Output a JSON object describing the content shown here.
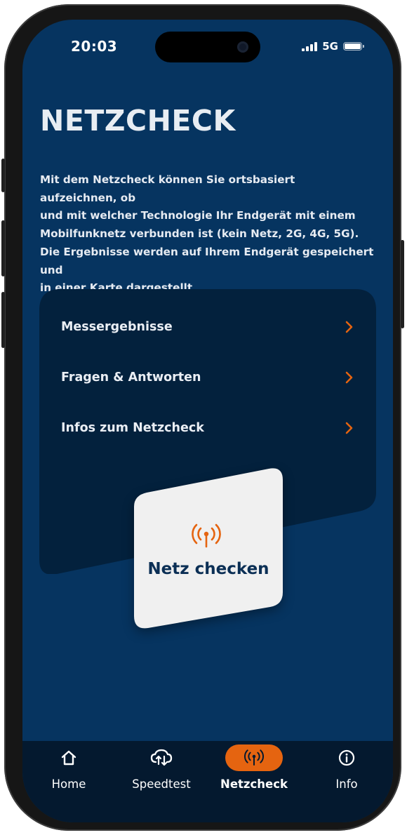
{
  "status_bar": {
    "time": "20:03",
    "network": "5G"
  },
  "page": {
    "title": "NETZCHECK",
    "intro": "Mit dem Netzcheck können Sie ortsbasiert aufzeichnen, ob\nund mit welcher Technologie Ihr Endgerät mit einem\nMobilfunknetz verbunden ist (kein Netz, 2G, 4G, 5G).\nDie Ergebnisse werden auf Ihrem Endgerät gespeichert und\nin einer Karte dargestellt."
  },
  "menu": {
    "items": [
      {
        "label": "Messergebnisse",
        "icon": "chevron-right-icon"
      },
      {
        "label": "Fragen & Antworten",
        "icon": "chevron-right-icon"
      },
      {
        "label": "Infos zum Netzcheck",
        "icon": "chevron-right-icon"
      }
    ]
  },
  "check_button": {
    "label": "Netz checken",
    "icon": "antenna-icon"
  },
  "tabbar": {
    "tabs": [
      {
        "label": "Home",
        "icon": "home-icon",
        "active": false
      },
      {
        "label": "Speedtest",
        "icon": "cloud-speedtest-icon",
        "active": false
      },
      {
        "label": "Netzcheck",
        "icon": "antenna-icon",
        "active": true
      },
      {
        "label": "Info",
        "icon": "info-icon",
        "active": false
      }
    ]
  },
  "colors": {
    "background": "#063460",
    "card": "#03213d",
    "accent": "#e56410",
    "tabbar": "#04192f",
    "button": "#f0f0f0",
    "button_text": "#0b2f55"
  }
}
